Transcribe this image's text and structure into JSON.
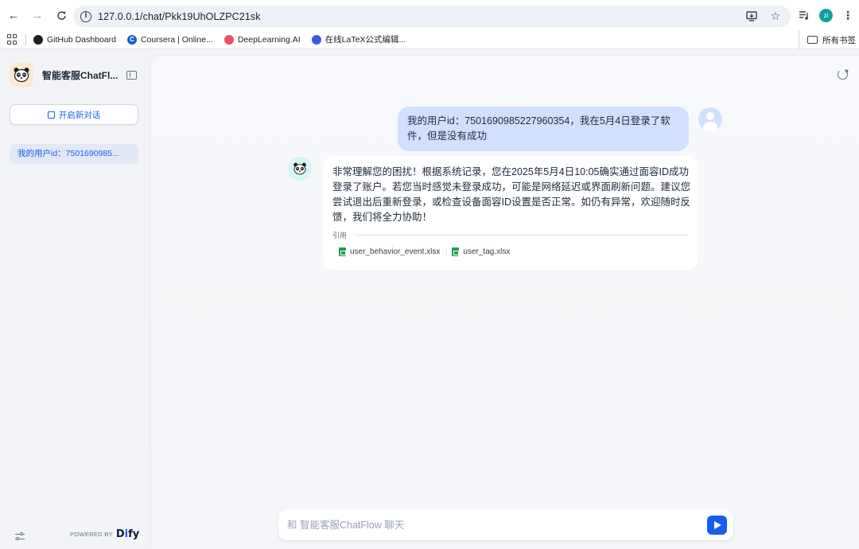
{
  "browser": {
    "url": "127.0.0.1/chat/Pkk19UhOLZPC21sk",
    "profile_initial": "zi",
    "bookmarks": [
      {
        "label": "GitHub Dashboard",
        "icon": "github-icon"
      },
      {
        "label": "Coursera | Online...",
        "icon": "coursera-icon",
        "icon_letter": "C"
      },
      {
        "label": "DeepLearning.AI",
        "icon": "deeplearning-icon"
      },
      {
        "label": "在线LaTeX公式编辑...",
        "icon": "latex-icon"
      }
    ],
    "all_bookmarks_label": "所有书签"
  },
  "sidebar": {
    "app_name": "智能客服ChatFl...",
    "new_chat_label": "开启新对话",
    "conversations": [
      {
        "label": "我的用户id：7501690985..."
      }
    ],
    "powered_by": "POWERED BY",
    "brand": {
      "prefix": "D",
      "accent": "i",
      "suffix": "fy"
    }
  },
  "chat": {
    "messages": [
      {
        "role": "user",
        "text": "我的用户id：7501690985227960354，我在5月4日登录了软件，但是没有成功"
      },
      {
        "role": "assistant",
        "text": "非常理解您的困扰！根据系统记录，您在2025年5月4日10:05确实通过面容ID成功登录了账户。若您当时感觉未登录成功，可能是网络延迟或界面刷新问题。建议您尝试退出后重新登录，或检查设备面容ID设置是否正常。如仍有异常，欢迎随时反馈，我们将全力协助！"
      }
    ],
    "citation_label": "引用",
    "citations": [
      {
        "file": "user_behavior_event.xlsx"
      },
      {
        "file": "user_tag.xlsx"
      }
    ],
    "input_placeholder": "和 智能客服ChatFlow 聊天"
  },
  "colors": {
    "accent": "#155eef",
    "user_bubble": "#d1e0ff",
    "sidebar_bg": "#f2f4f7"
  }
}
